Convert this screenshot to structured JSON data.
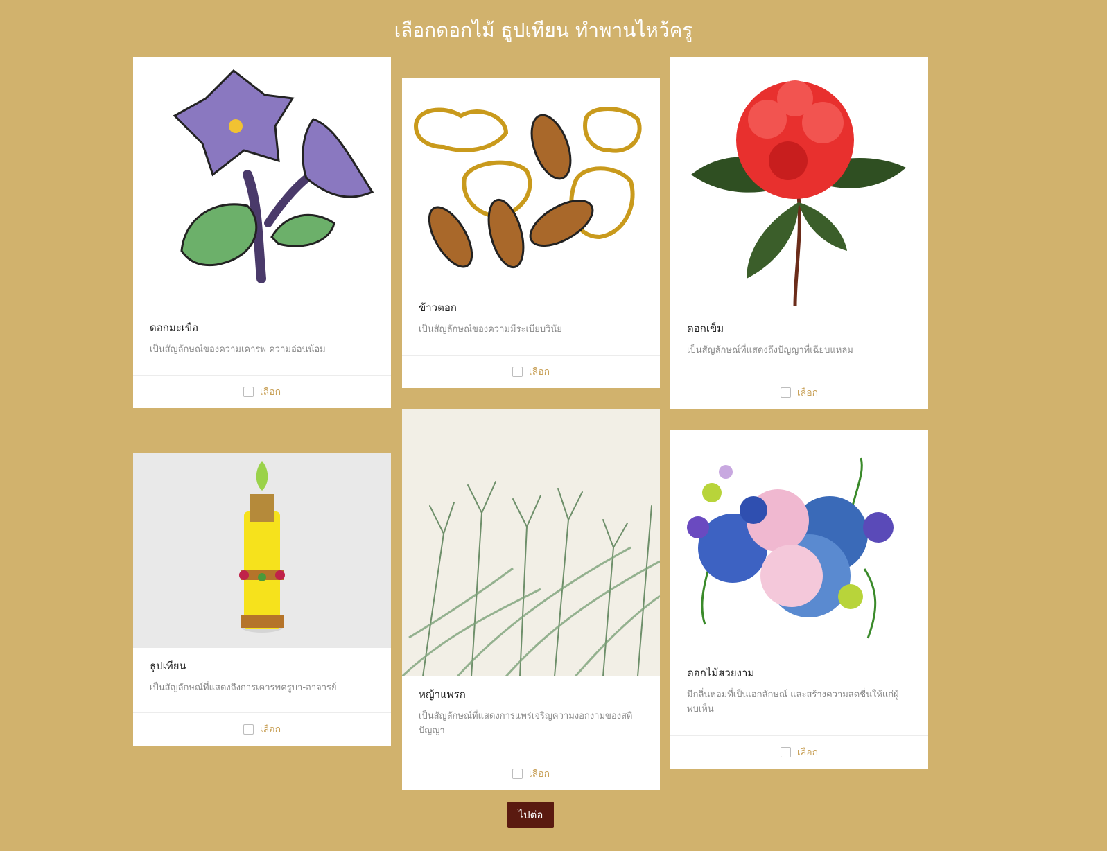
{
  "page": {
    "title": "เลือกดอกไม้ ธูปเทียน ทำพานไหว้ครู",
    "accent_color": "#d1b26d",
    "button_color": "#5a1a10"
  },
  "cards": [
    {
      "name": "ดอกมะเขือ",
      "description": "เป็นสัญลักษณ์ของความเคารพ ความอ่อนน้อม",
      "select_label": "เลือก",
      "image": "eggplant-flower-illustration"
    },
    {
      "name": "ข้าวตอก",
      "description": "เป็นสัญลักษณ์ของความมีระเบียบวินัย",
      "select_label": "เลือก",
      "image": "puffed-rice-illustration"
    },
    {
      "name": "ดอกเข็ม",
      "description": "เป็นสัญลักษณ์ที่แสดงถึงปัญญาที่เฉียบแหลม",
      "select_label": "เลือก",
      "image": "ixora-flower-illustration"
    },
    {
      "name": "ธูปเทียน",
      "description": "เป็นสัญลักษณ์ที่แสดงถึงการเคารพครูบา-อาจารย์",
      "select_label": "เลือก",
      "image": "incense-candle-photo"
    },
    {
      "name": "หญ้าแพรก",
      "description": "เป็นสัญลักษณ์ที่แสดงการแพร่เจริญความงอกงามของสติปัญญา",
      "select_label": "เลือก",
      "image": "bermuda-grass-watercolor"
    },
    {
      "name": "ดอกไม้สวยงาม",
      "description": "มีกลิ่นหอมที่เป็นเอกลักษณ์ และสร้างความสดชื่นให้แก่ผู้พบเห็น",
      "select_label": "เลือก",
      "image": "flower-bouquet-watercolor"
    }
  ],
  "next_button": {
    "label": "ไปต่อ"
  }
}
